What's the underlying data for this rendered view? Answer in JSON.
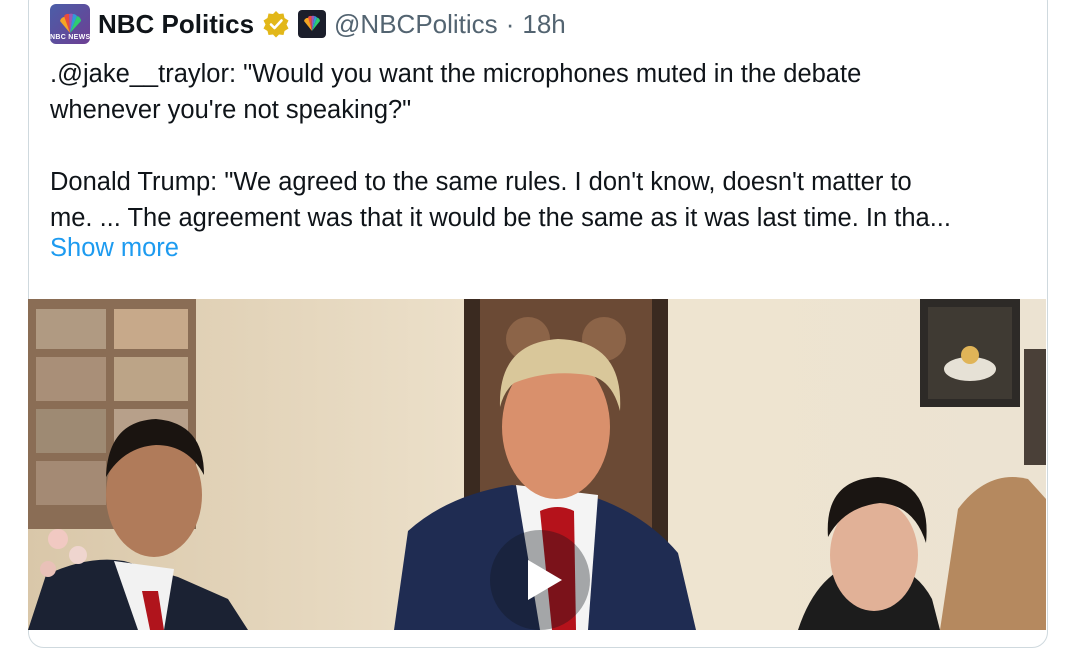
{
  "post": {
    "author_name": "NBC Politics",
    "avatar_caption": "NBC NEWS",
    "handle": "@NBCPolitics",
    "separator": "·",
    "time": "18h",
    "text_lines": [
      ".@jake__traylor: \"Would you want the microphones muted in the debate",
      "whenever you're not speaking?\"",
      "Donald Trump: \"We agreed to the same rules. I don't know, doesn't matter to",
      "me. ... The agreement was that it would be the same as it was last time. In tha..."
    ],
    "show_more": "Show more"
  },
  "colors": {
    "link": "#1d9bf0",
    "secondary_text": "#536471",
    "verified_gold": "#e2b719"
  },
  "icons": {
    "verified": "gold-verified-badge-icon",
    "affiliate": "nbc-peacock-icon",
    "play": "play-icon"
  }
}
